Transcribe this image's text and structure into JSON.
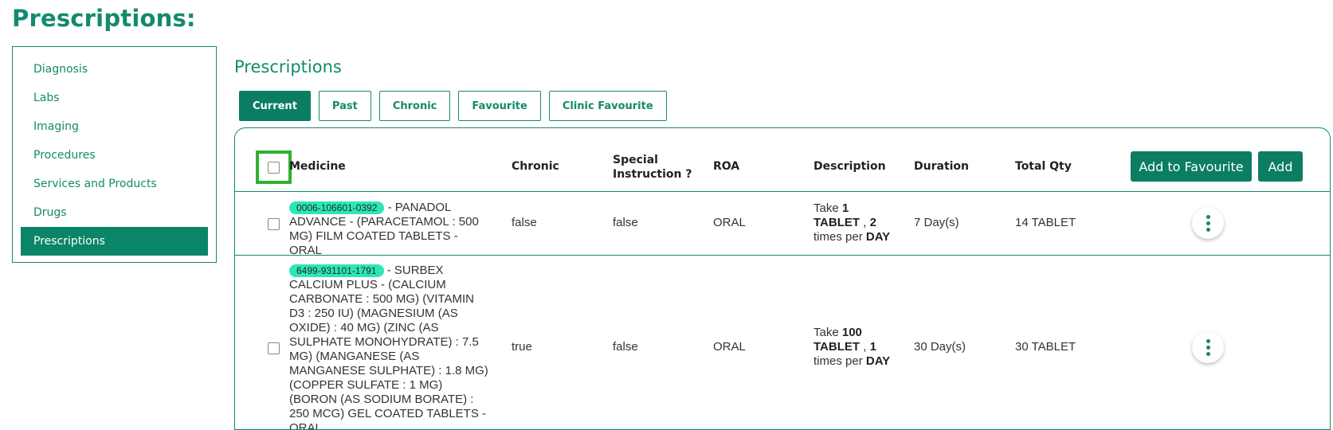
{
  "page": {
    "title": "Prescriptions:"
  },
  "sidebar": {
    "items": [
      {
        "label": "Diagnosis"
      },
      {
        "label": "Labs"
      },
      {
        "label": "Imaging"
      },
      {
        "label": "Procedures"
      },
      {
        "label": "Services and Products"
      },
      {
        "label": "Drugs"
      },
      {
        "label": "Prescriptions",
        "active": true
      }
    ]
  },
  "main": {
    "section_title": "Prescriptions",
    "tabs": [
      {
        "label": "Current",
        "active": true
      },
      {
        "label": "Past"
      },
      {
        "label": "Chronic"
      },
      {
        "label": "Favourite"
      },
      {
        "label": "Clinic Favourite"
      }
    ]
  },
  "table": {
    "headers": {
      "medicine": "Medicine",
      "chronic": "Chronic",
      "special_1": "Special",
      "special_2": "Instruction ?",
      "roa": "ROA",
      "description": "Description",
      "duration": "Duration",
      "total_qty": "Total Qty"
    },
    "actions": {
      "add_to_favourite": "Add to Favourite",
      "add": "Add"
    },
    "rows": [
      {
        "code": "0006-106601-0392",
        "medicine_text": "- PANADOL ADVANCE - (PARACETAMOL : 500 MG) FILM COATED TABLETS - ORAL",
        "chronic": "false",
        "special_instruction": "false",
        "roa": "ORAL",
        "desc_take": "Take",
        "desc_qty": "1",
        "desc_unit": "TABLET",
        "desc_sep": " , ",
        "desc_times": "2",
        "desc_times_per": "times per",
        "desc_period": "DAY",
        "duration": "7 Day(s)",
        "total_qty": "14 TABLET"
      },
      {
        "code": "6499-931101-1791",
        "medicine_text": "- SURBEX CALCIUM PLUS - (CALCIUM CARBONATE : 500 MG) (VITAMIN D3 : 250 IU) (MAGNESIUM (AS OXIDE) : 40 MG) (ZINC (AS SULPHATE MONOHYDRATE) : 7.5 MG) (MANGANESE (AS MANGANESE SULPHATE) : 1.8 MG) (COPPER SULFATE : 1 MG) (BORON (AS SODIUM BORATE) : 250 MCG) GEL COATED TABLETS - ORAL",
        "chronic": "true",
        "special_instruction": "false",
        "roa": "ORAL",
        "desc_take": "Take",
        "desc_qty": "100",
        "desc_unit": "TABLET",
        "desc_sep": " , ",
        "desc_times": "1",
        "desc_times_per": "times per",
        "desc_period": "DAY",
        "duration": "30 Day(s)",
        "total_qty": "30 TABLET"
      }
    ]
  },
  "colors": {
    "brand": "#148a6c",
    "brand_dark": "#0b7d62",
    "badge": "#2ee6b5",
    "highlight": "#2fb12f"
  }
}
